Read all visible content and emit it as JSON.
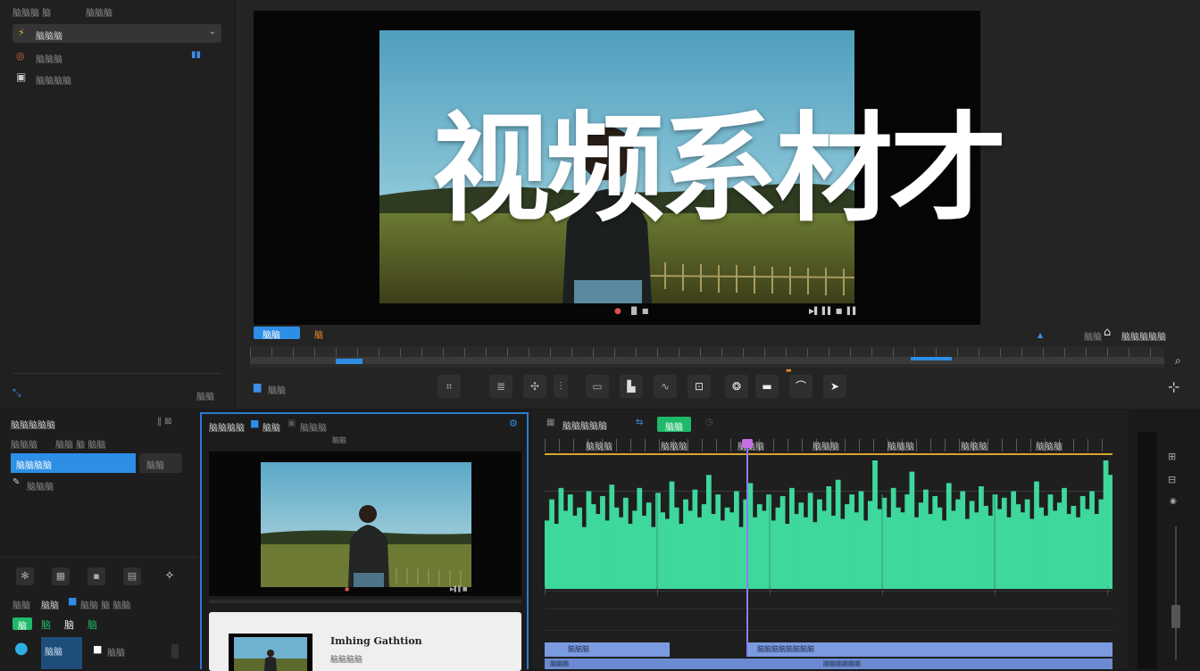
{
  "overlay_title": "视频系材才",
  "left_top": {
    "header_items": [
      "脑脑脑 脑",
      "脑脑脑"
    ],
    "dropdown_label": "脑脑脑",
    "list": [
      {
        "icon": "circle-icon",
        "label": "脑脑脑"
      },
      {
        "icon": "square-icon",
        "label": "脑脑脑脑"
      }
    ],
    "bottom_label": "脑脑"
  },
  "viewer": {
    "tab_active": "脑脑",
    "tab_orange": "脑",
    "right_labels": [
      "脑脑脑脑脑"
    ],
    "marker_label": "脑脑",
    "tools": [
      "crop-icon",
      "stack-icon",
      "arrow-icon",
      "blade-icon",
      "link-icon",
      "speed-icon",
      "wave-icon",
      "frame-icon",
      "mask-icon",
      "transition-icon",
      "curve-icon",
      "next-icon"
    ]
  },
  "media_panel": {
    "title": "脑脑脑脑脑",
    "sub_labels": [
      "脑脑脑",
      "脑脑 脑 脑脑"
    ],
    "selected_item": "脑脑脑脑",
    "selected_aux": "脑脑",
    "item2": "脑脑脑",
    "row_tools": [
      "clock-icon",
      "grid-icon",
      "cube-icon",
      "tile-icon",
      "sparkle-icon"
    ],
    "label_row": [
      "脑脑",
      "脑脑"
    ],
    "color_chips": [
      "脑",
      "脑",
      "脑",
      "脑"
    ],
    "bottom_label": "脑脑"
  },
  "preview_panel": {
    "title": "脑脑脑脑",
    "tag": "脑脑",
    "alt_tag": "脑脑脑",
    "mini_label": "脑脑",
    "card_title": "Imhing Gathtion",
    "card_sub": "脑脑脑脑"
  },
  "timeline": {
    "title": "脑脑脑脑脑",
    "badge": "脑脑",
    "ruler_labels": [
      "脑脑脑",
      "脑脑脑",
      "脑脑脑",
      "脑脑脑",
      "脑脑脑",
      "脑脑脑",
      "脑脑脑"
    ],
    "waveform": [
      42,
      55,
      40,
      62,
      48,
      58,
      45,
      50,
      38,
      60,
      52,
      46,
      57,
      42,
      64,
      50,
      44,
      56,
      40,
      48,
      62,
      45,
      53,
      38,
      59,
      47,
      43,
      66,
      50,
      40,
      55,
      48,
      61,
      44,
      52,
      70,
      46,
      58,
      42,
      50,
      47,
      60,
      38,
      55,
      65,
      44,
      52,
      48,
      58,
      42,
      50,
      57,
      40,
      62,
      46,
      53,
      44,
      59,
      41,
      55,
      48,
      63,
      45,
      67,
      43,
      52,
      58,
      47,
      60,
      42,
      54,
      80,
      49,
      56,
      44,
      62,
      50,
      47,
      58,
      72,
      44,
      53,
      61,
      46,
      57,
      50,
      42,
      65,
      48,
      55,
      60,
      43,
      54,
      47,
      63,
      51,
      45,
      58,
      49,
      56,
      44,
      60,
      52,
      47,
      55,
      43,
      66,
      50,
      45,
      58,
      48,
      53,
      62,
      46,
      51,
      44,
      57,
      49,
      60,
      46,
      55,
      85,
      70
    ],
    "clip_labels": [
      "脑脑脑",
      "脑脑脑脑脑脑脑脑",
      "脑脑脑",
      "脑脑脑脑脑脑"
    ]
  },
  "colors": {
    "accent": "#2d8ee6",
    "wave": "#3ed79c",
    "playhead": "#8a7cf0",
    "clip": "#7b9be0"
  }
}
